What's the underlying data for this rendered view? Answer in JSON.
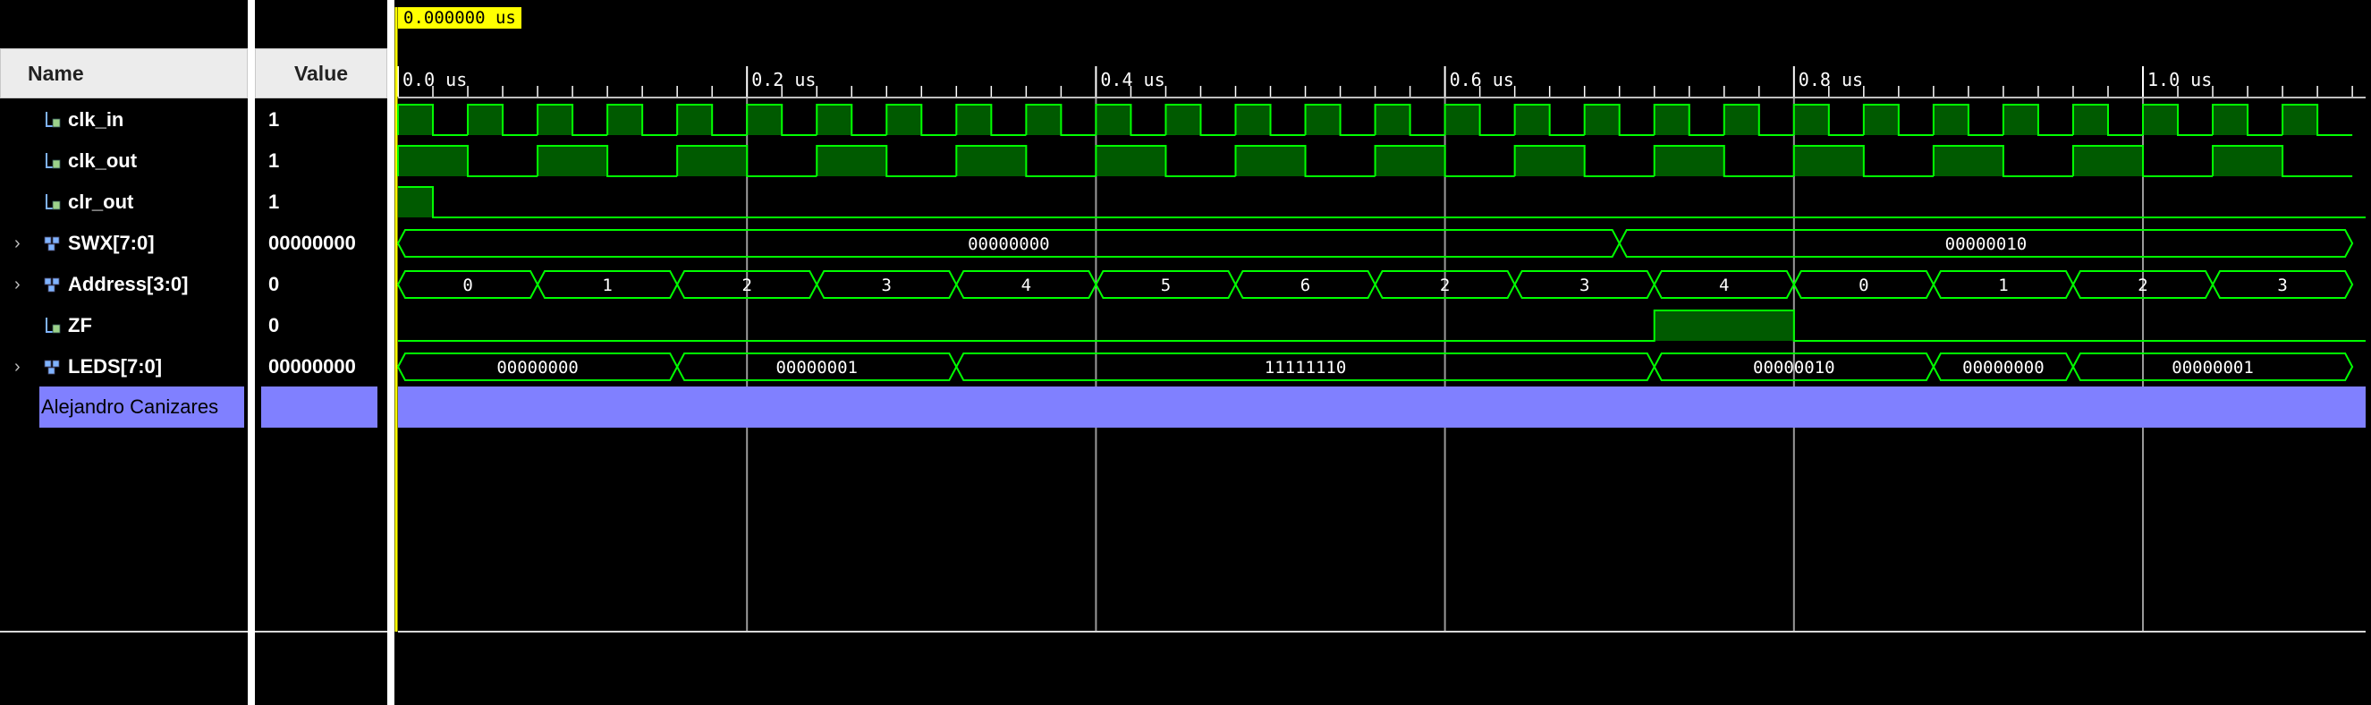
{
  "cursor": {
    "time_label": "0.000000 us"
  },
  "columns": {
    "name": "Name",
    "value": "Value"
  },
  "signals": [
    {
      "name": "clk_in",
      "value": "1",
      "kind": "bit",
      "expandable": false
    },
    {
      "name": "clk_out",
      "value": "1",
      "kind": "bit",
      "expandable": false
    },
    {
      "name": "clr_out",
      "value": "1",
      "kind": "bit",
      "expandable": false
    },
    {
      "name": "SWX[7:0]",
      "value": "00000000",
      "kind": "bus",
      "expandable": true
    },
    {
      "name": "Address[3:0]",
      "value": "0",
      "kind": "bus",
      "expandable": true
    },
    {
      "name": "ZF",
      "value": "0",
      "kind": "bit",
      "expandable": false
    },
    {
      "name": "LEDS[7:0]",
      "value": "00000000",
      "kind": "bus",
      "expandable": true
    }
  ],
  "divider": {
    "label": "Alejandro Canizares"
  },
  "chart_data": {
    "type": "waveform",
    "x_unit": "us",
    "xlim": [
      0,
      1.12
    ],
    "time_ticks": [
      "0.0 us",
      "0.2 us",
      "0.4 us",
      "0.6 us",
      "0.8 us",
      "1.0 us"
    ],
    "tick_values": [
      0.0,
      0.2,
      0.4,
      0.6,
      0.8,
      1.0
    ],
    "clk_in_period_us": 0.04,
    "clk_out_period_us": 0.08,
    "clr_out_high_until_us": 0.02,
    "SWX": [
      {
        "start": 0.0,
        "end": 0.7,
        "value": "00000000"
      },
      {
        "start": 0.7,
        "end": 1.12,
        "value": "00000010"
      }
    ],
    "Address": [
      {
        "start": 0.0,
        "end": 0.08,
        "value": "0"
      },
      {
        "start": 0.08,
        "end": 0.16,
        "value": "1"
      },
      {
        "start": 0.16,
        "end": 0.24,
        "value": "2"
      },
      {
        "start": 0.24,
        "end": 0.32,
        "value": "3"
      },
      {
        "start": 0.32,
        "end": 0.4,
        "value": "4"
      },
      {
        "start": 0.4,
        "end": 0.48,
        "value": "5"
      },
      {
        "start": 0.48,
        "end": 0.56,
        "value": "6"
      },
      {
        "start": 0.56,
        "end": 0.64,
        "value": "2"
      },
      {
        "start": 0.64,
        "end": 0.72,
        "value": "3"
      },
      {
        "start": 0.72,
        "end": 0.8,
        "value": "4"
      },
      {
        "start": 0.8,
        "end": 0.88,
        "value": "0"
      },
      {
        "start": 0.88,
        "end": 0.96,
        "value": "1"
      },
      {
        "start": 0.96,
        "end": 1.04,
        "value": "2"
      },
      {
        "start": 1.04,
        "end": 1.12,
        "value": "3"
      }
    ],
    "ZF_high": [
      [
        0.72,
        0.8
      ]
    ],
    "LEDS": [
      {
        "start": 0.0,
        "end": 0.16,
        "value": "00000000"
      },
      {
        "start": 0.16,
        "end": 0.32,
        "value": "00000001"
      },
      {
        "start": 0.32,
        "end": 0.72,
        "value": "11111110"
      },
      {
        "start": 0.72,
        "end": 0.88,
        "value": "00000010"
      },
      {
        "start": 0.88,
        "end": 0.96,
        "value": "00000000"
      },
      {
        "start": 0.96,
        "end": 1.12,
        "value": "00000001"
      }
    ]
  },
  "colors": {
    "wave": "#00ff00",
    "wave_fill": "#005a00",
    "cursor": "#ffff00",
    "gridline": "#9a9a9a",
    "divider": "#8080ff"
  }
}
